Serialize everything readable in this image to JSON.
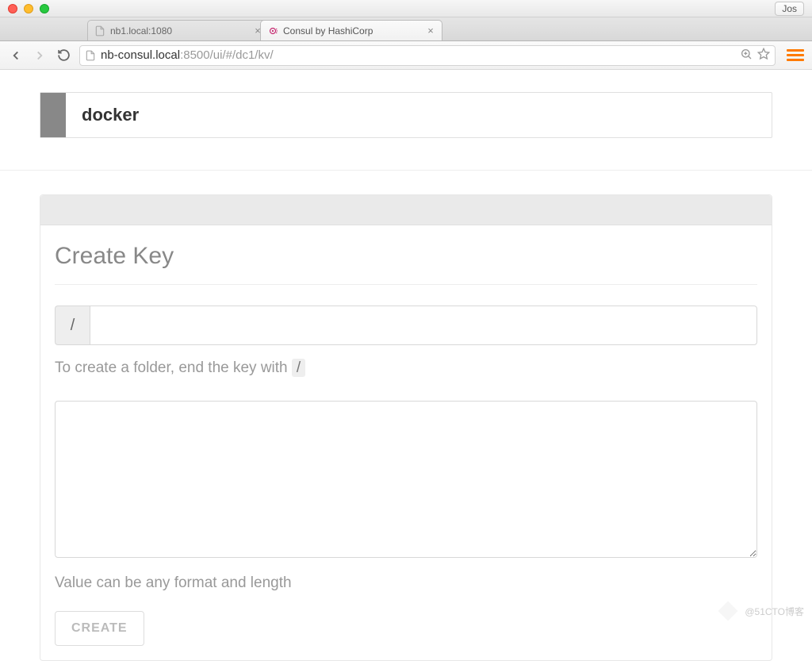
{
  "window": {
    "profile_label": "Jos"
  },
  "tabs": [
    {
      "title": "nb1.local:1080",
      "active": false
    },
    {
      "title": "Consul by HashiCorp",
      "active": true
    }
  ],
  "address_bar": {
    "host": "nb-consul.local",
    "port_path": ":8500/ui/#/dc1/kv/"
  },
  "kv": {
    "current_key": "docker"
  },
  "panel": {
    "title": "Create Key",
    "path_prefix": "/",
    "key_input_value": "",
    "folder_hint_pre": "To create a folder, end the key with ",
    "folder_hint_code": "/",
    "value_input_value": "",
    "value_hint": "Value can be any format and length",
    "create_label": "CREATE"
  },
  "watermark": "@51CTO博客"
}
